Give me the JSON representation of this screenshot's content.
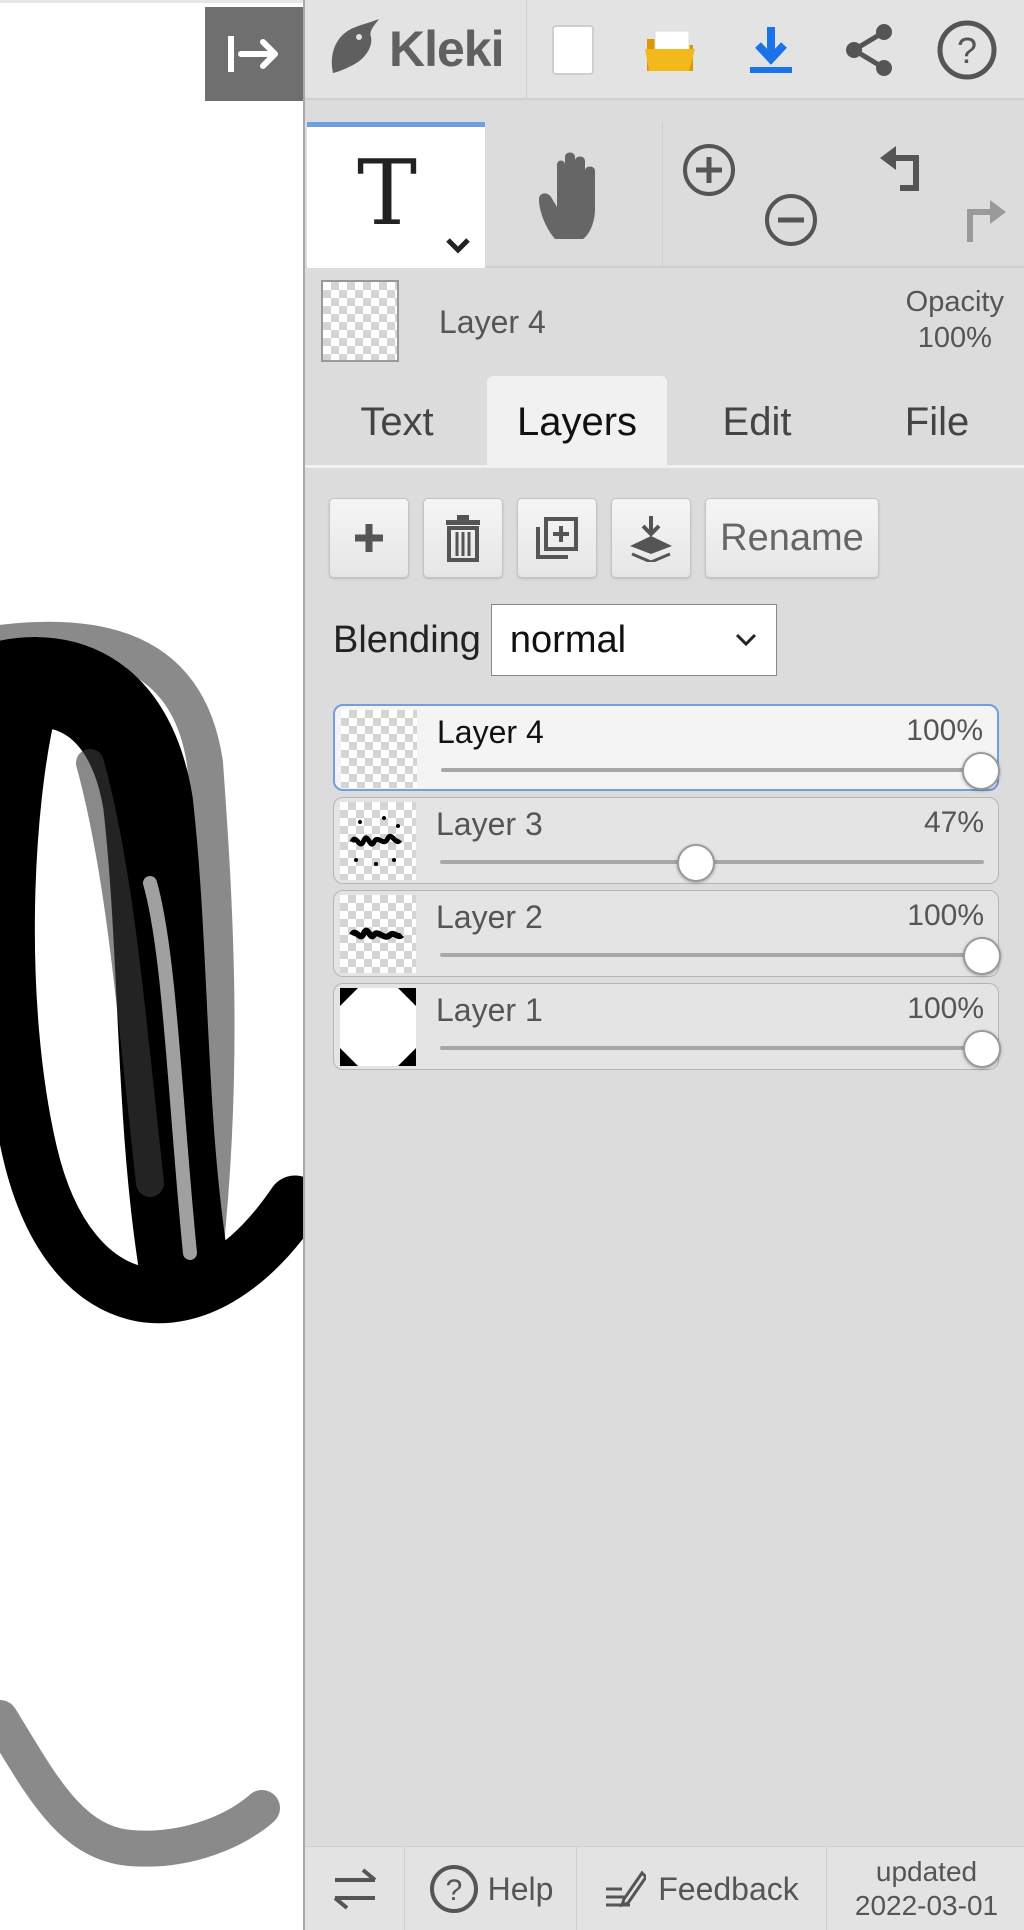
{
  "app": {
    "name": "Kleki"
  },
  "top_icons": [
    "new-file-icon",
    "open-folder-icon",
    "download-icon",
    "share-icon",
    "help-icon"
  ],
  "tools": {
    "active_tool": "text",
    "tool_icons": [
      "text-tool-icon",
      "hand-tool-icon",
      "zoom-in-icon",
      "zoom-out-icon",
      "undo-icon",
      "redo-icon"
    ]
  },
  "layer_info": {
    "name": "Layer 4",
    "opacity_label": "Opacity",
    "opacity_value": "100%"
  },
  "tabs": [
    {
      "label": "Text",
      "active": false
    },
    {
      "label": "Layers",
      "active": true
    },
    {
      "label": "Edit",
      "active": false
    },
    {
      "label": "File",
      "active": false
    }
  ],
  "layers_panel": {
    "toolbar_icons": [
      "add-layer-icon",
      "delete-layer-icon",
      "duplicate-layer-icon",
      "merge-down-icon"
    ],
    "rename_label": "Rename",
    "blending_label": "Blending",
    "blending_value": "normal",
    "layers": [
      {
        "name": "Layer 4",
        "opacity": "100%",
        "level": 1.0,
        "selected": true
      },
      {
        "name": "Layer 3",
        "opacity": "47%",
        "level": 0.47,
        "selected": false
      },
      {
        "name": "Layer 2",
        "opacity": "100%",
        "level": 1.0,
        "selected": false
      },
      {
        "name": "Layer 1",
        "opacity": "100%",
        "level": 1.0,
        "selected": false
      }
    ]
  },
  "bottom_bar": {
    "help_label": "Help",
    "feedback_label": "Feedback",
    "updated_label": "updated",
    "updated_date": "2022-03-01"
  },
  "colors": {
    "accent": "#6f9fe0",
    "download": "#1a73e8",
    "folder": "#f2b81c",
    "sidebar_bg": "#dcdcdc"
  }
}
